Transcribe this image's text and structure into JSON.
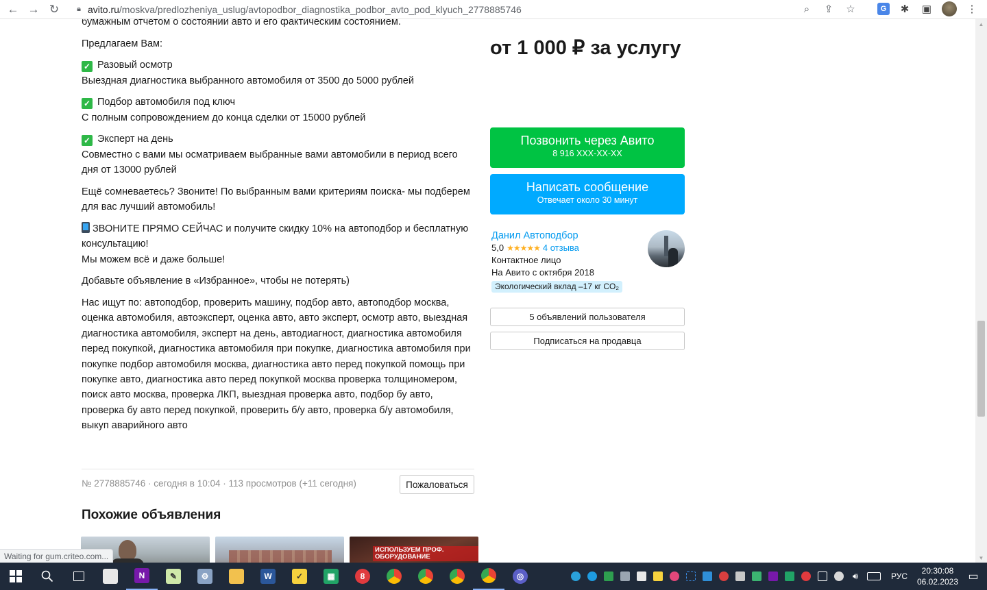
{
  "browser": {
    "url_host": "avito.ru",
    "url_path": "/moskva/predlozheniya_uslug/avtopodbor_diagnostika_podbor_avto_pod_klyuch_2778885746",
    "status_text": "Waiting for gum.criteo.com..."
  },
  "description": {
    "cut_line": "бумажным отчетом о состоянии авто и его фактическим состоянием.",
    "offer_intro": "Предлагаем Вам:",
    "items": [
      {
        "title": "Разовый осмотр",
        "text": "Выездная диагностика выбранного автомобиля от 3500 до 5000 рублей"
      },
      {
        "title": "Подбор автомобиля под ключ",
        "text": "С полным сопровождением до конца сделки от 15000 рублей"
      },
      {
        "title": "Эксперт на день",
        "text": "Совместно с вами мы осматриваем выбранные вами автомобили в период всего дня от 13000 рублей"
      }
    ],
    "doubt": "Ещё сомневаетесь? Звоните! По выбранным вами критериям поиска- мы подберем для вас лучший автомобиль!",
    "call_now": "ЗВОНИТЕ ПРЯМО СЕЙЧАС и получите скидку 10% на автоподбор и бесплатную консультацию!",
    "can_more": "Мы можем всё и даже больше!",
    "favorites": "Добавьте объявление в «Избранное», чтобы не потерять)",
    "keywords": "Нас ищут по: автоподбор, проверить машину, подбор авто, автоподбор москва, оценка автомобиля, автоэксперт, оценка авто, авто эксперт, осмотр авто, выездная диагностика автомобиля, эксперт на день, автодиагност, диагностика автомобиля перед покупкой, диагностика автомобиля при покупке, диагностика автомобиля при покупке подбор автомобиля москва, диагностика авто перед покупкой помощь при покупке авто, диагностика авто перед покупкой москва проверка толщиномером, поиск авто москва, проверка ЛКП, выездная проверка авто, подбор бу авто, проверка бу авто перед покупкой, проверить б/у авто, проверка б/у автомобиля, выкуп аварийного авто"
  },
  "meta": {
    "text": "№ 2778885746 · сегодня в 10:04 · 113 просмотров (+11 сегодня)",
    "report_label": "Пожаловаться"
  },
  "similar": {
    "title": "Похожие объявления",
    "thumb3_caption": "ИСПОЛЬЗУЕМ ПРОФ. ОБОРУДОВАНИЕ"
  },
  "sidebar": {
    "price": "от 1 000 ₽ за услугу",
    "call_button": {
      "label": "Позвонить через Авито",
      "sub": "8 916 XXX-XX-XX"
    },
    "message_button": {
      "label": "Написать сообщение",
      "sub": "Отвечает около 30 минут"
    },
    "seller": {
      "name": "Данил Автоподбор",
      "rating": "5,0",
      "stars": "★★★★★",
      "reviews": "4 отзыва",
      "role": "Контактное лицо",
      "since": "На Авито с октября 2018",
      "eco": "Экологический вклад –17 кг CO₂"
    },
    "ads_button": "5 объявлений пользователя",
    "subscribe_button": "Подписаться на продавца"
  },
  "taskbar": {
    "lang": "РУС",
    "time": "20:30:08",
    "date": "06.02.2023"
  }
}
